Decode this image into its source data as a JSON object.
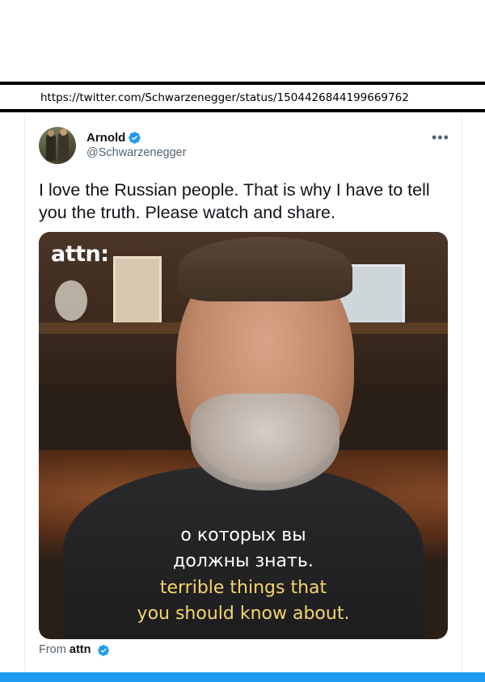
{
  "browser": {
    "url": "https://twitter.com/Schwarzenegger/status/1504426844199669762"
  },
  "tweet": {
    "display_name": "Arnold",
    "handle": "@Schwarzenegger",
    "more_glyph": "•••",
    "text": "I love the Russian people. That is why I have to tell you the truth. Please watch and share.",
    "from_prefix": "From",
    "from_source": "attn"
  },
  "video": {
    "logo": "attn:",
    "subtitles": {
      "ru_line1": "о которых вы",
      "ru_line2": "должны знать.",
      "en_line1": "terrible things that",
      "en_line2": "you should know about."
    }
  },
  "icons": {
    "verified": "verified-badge-icon",
    "more": "more-options-icon"
  },
  "colors": {
    "accent": "#1d9bf0",
    "text_primary": "#0f1419",
    "text_secondary": "#536471",
    "subtitle_en": "#f5d56a"
  }
}
